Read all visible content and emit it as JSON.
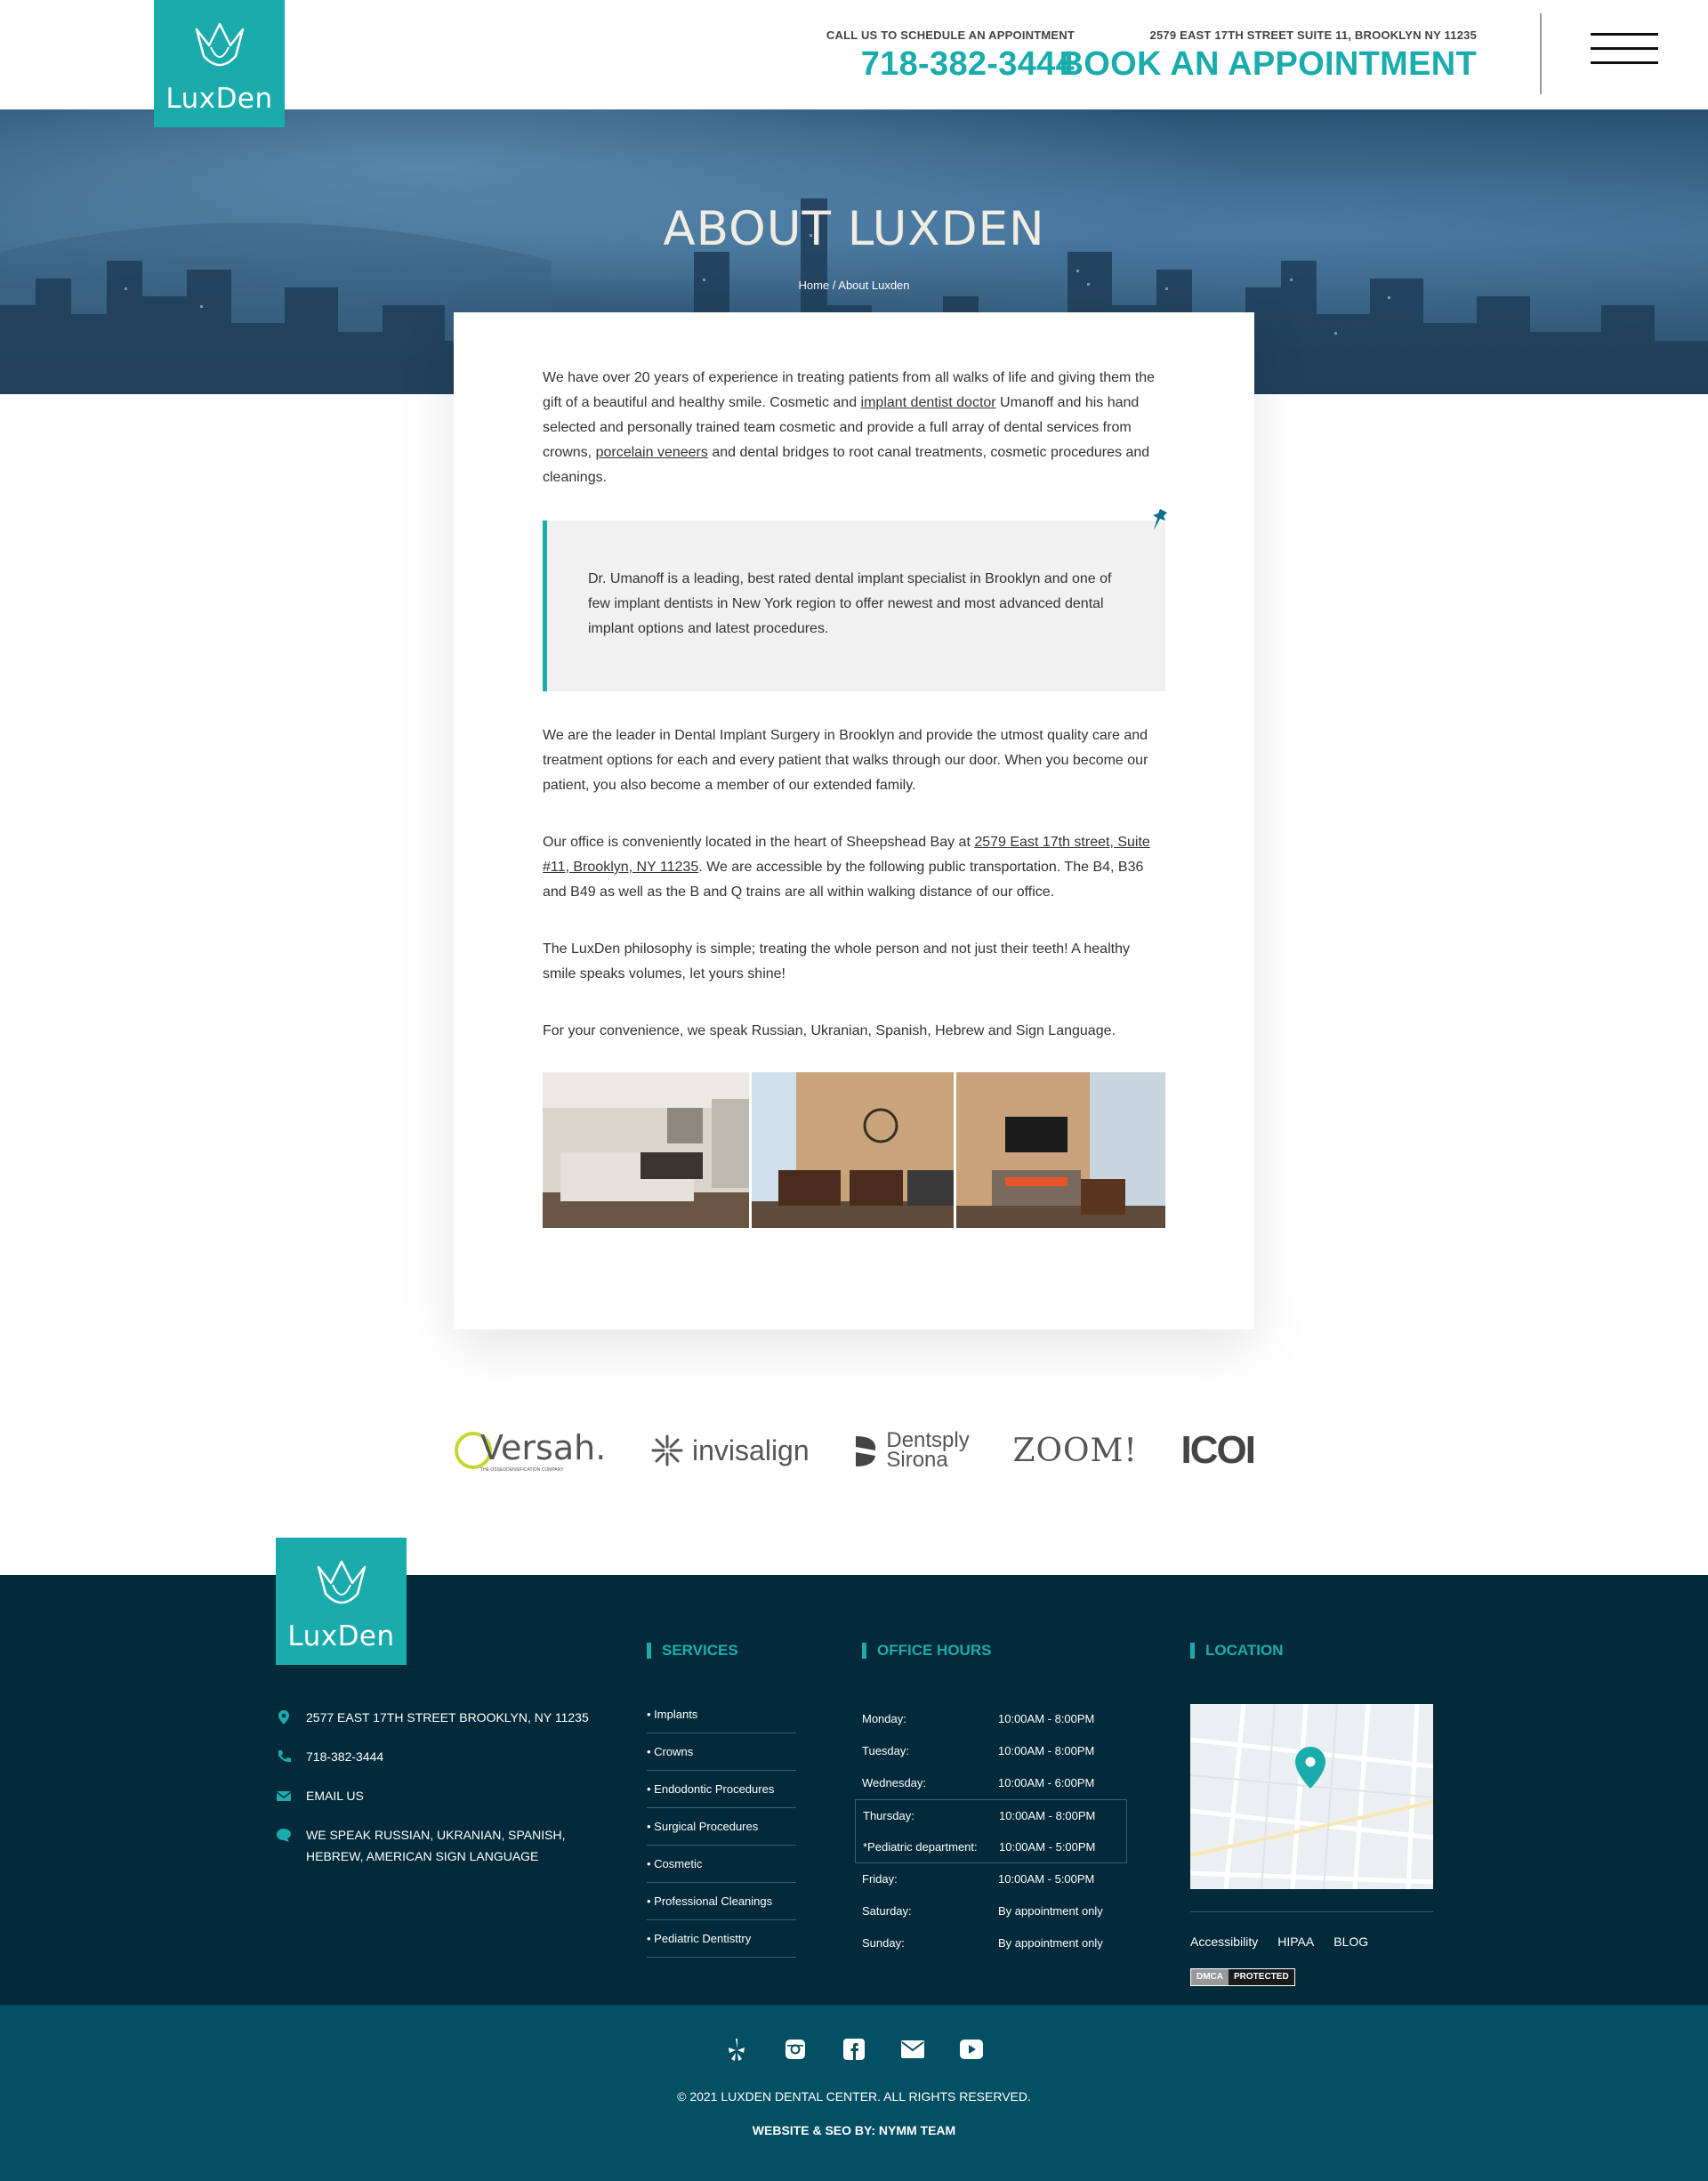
{
  "brand": {
    "logo_text": "LuxDen",
    "accent": "#1aacac",
    "footer_bg": "#022a3a",
    "subfooter_bg": "#034f63"
  },
  "header": {
    "call_label": "CALL US TO SCHEDULE AN APPOINTMENT",
    "phone": "718-382-3444",
    "address_label": "2579 EAST 17TH STREET SUITE 11, BROOKLYN NY 11235",
    "book_label": "BOOK AN APPOINTMENT",
    "menu_icon": "hamburger-icon"
  },
  "hero": {
    "title": "ABOUT LUXDEN",
    "breadcrumb_home": "Home",
    "breadcrumb_sep": " / ",
    "breadcrumb_current": "About Luxden"
  },
  "content": {
    "p1_a": "We have over 20 years of experience in treating patients from all walks of life and giving them the gift of a beautiful and healthy smile. Cosmetic and ",
    "p1_link1": "implant dentist doctor",
    "p1_b": " Umanoff and his hand selected and personally trained team cosmetic and provide a full array of dental services from crowns, ",
    "p1_link2": "porcelain veneers",
    "p1_c": " and dental bridges to root canal treatments, cosmetic procedures and cleanings.",
    "quote": "Dr. Umanoff is a leading, best rated dental implant specialist in Brooklyn and one of few implant dentists in New York region to offer newest and most advanced dental implant options and latest procedures.",
    "p2": "We are the leader in Dental Implant Surgery in Brooklyn and provide the utmost quality care and treatment options for each and every patient that walks through our door. When you become our patient, you also become a member of our extended family.",
    "p3_a": "Our office is conveniently located in the heart of Sheepshead Bay at ",
    "p3_link": "2579 East 17th street, Suite #11, Brooklyn, NY 11235",
    "p3_b": ". We are accessible by the following public transportation. The B4, B36 and B49 as well as the B and Q trains are all within walking distance of our office.",
    "p4": "The LuxDen philosophy is simple; treating the whole person and not just their teeth! A healthy smile speaks volumes, let yours shine!",
    "p5": "For your convenience, we speak Russian, Ukranian, Spanish, Hebrew and Sign Language."
  },
  "partners": [
    {
      "name": "Versah.",
      "sub": "THE OSSEODENSIFICATION COMPANY"
    },
    {
      "name": "invisalign"
    },
    {
      "name": "Dentsply",
      "name2": "Sirona"
    },
    {
      "name": "ZOOM!"
    },
    {
      "name": "ICOI"
    }
  ],
  "footer": {
    "contact": [
      {
        "icon": "location-pin-icon",
        "text": "2577 EAST 17TH STREET BROOKLYN, NY 11235"
      },
      {
        "icon": "phone-icon",
        "text": "718-382-3444"
      },
      {
        "icon": "mail-icon",
        "text": "EMAIL US"
      },
      {
        "icon": "chat-bubble-icon",
        "text": "WE SPEAK RUSSIAN, UKRANIAN, SPANISH, HEBREW, AMERICAN SIGN LANGUAGE"
      }
    ],
    "services_title": "SERVICES",
    "services": [
      "Implants",
      "Crowns",
      "Endodontic Procedures",
      "Surgical Procedures",
      "Cosmetic",
      "Professional Cleanings",
      "Pediatric Dentisttry"
    ],
    "hours_title": "OFFICE HOURS",
    "hours": [
      {
        "day": "Monday:",
        "time": "10:00AM - 8:00PM"
      },
      {
        "day": "Tuesday:",
        "time": "10:00AM - 8:00PM"
      },
      {
        "day": "Wednesday:",
        "time": "10:00AM - 6:00PM"
      },
      {
        "day": "Thursday:",
        "time": "10:00AM - 8:00PM"
      },
      {
        "day": "*Pediatric department:",
        "time": "10:00AM - 5:00PM"
      },
      {
        "day": "Friday:",
        "time": "10:00AM - 5:00PM"
      },
      {
        "day": "Saturday:",
        "time": "By appointment only"
      },
      {
        "day": "Sunday:",
        "time": "By appointment only"
      }
    ],
    "location_title": "LOCATION",
    "links": [
      "Accessibility",
      "HIPAA",
      "BLOG"
    ],
    "dmca_a": "DMCA",
    "dmca_b": "PROTECTED"
  },
  "subfooter": {
    "socials": [
      "yelp-icon",
      "instagram-icon",
      "facebook-icon",
      "email-icon",
      "youtube-icon"
    ],
    "copyright": "© 2021 LUXDEN DENTAL CENTER. ALL RIGHTS RESERVED.",
    "credit": "WEBSITE & SEO BY: NYMM TEAM"
  }
}
